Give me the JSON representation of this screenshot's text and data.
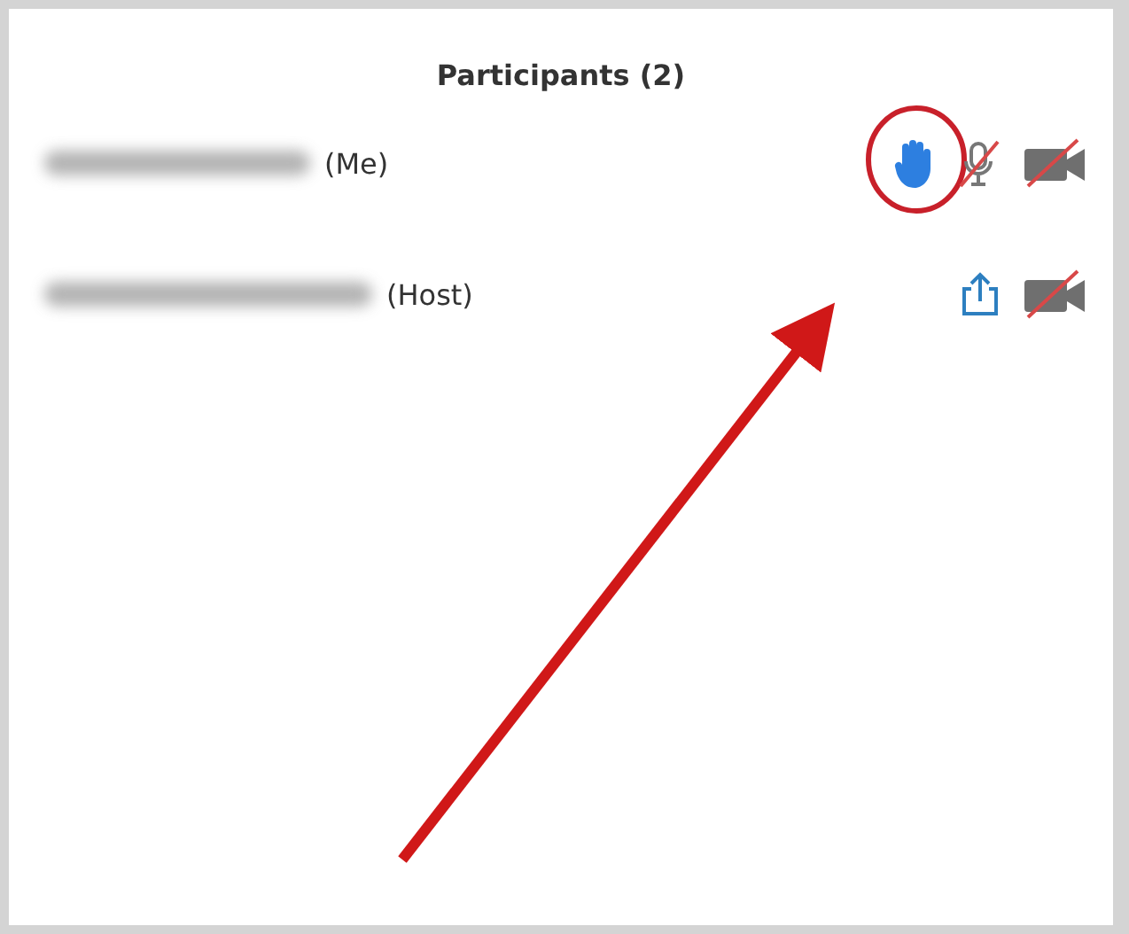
{
  "panel": {
    "title": "Participants (2)"
  },
  "participants": [
    {
      "name_blurred": true,
      "role": "(Me)",
      "icons": [
        {
          "kind": "hand",
          "circled": true
        },
        {
          "kind": "mic-muted"
        },
        {
          "kind": "video-off"
        }
      ]
    },
    {
      "name_blurred": true,
      "role": "(Host)",
      "icons": [
        {
          "kind": "share"
        },
        {
          "kind": "video-off"
        }
      ]
    }
  ],
  "annotations": [
    {
      "kind": "arrow"
    }
  ]
}
